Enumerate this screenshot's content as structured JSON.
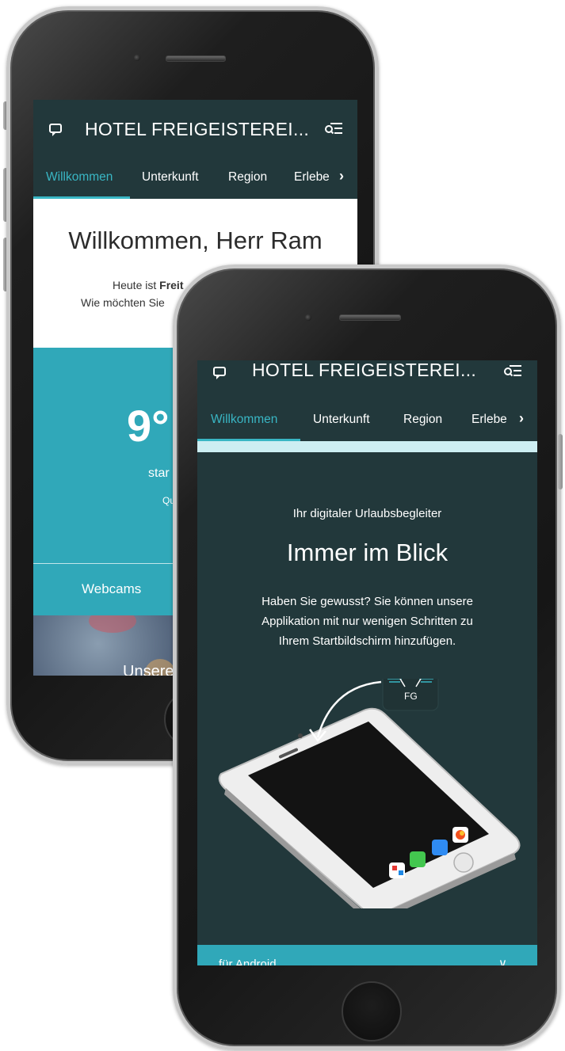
{
  "app": {
    "title": "HOTEL FREIGEISTEREI...",
    "tabs": [
      "Willkommen",
      "Unterkunft",
      "Region",
      "Erlebe"
    ],
    "active_tab": "Willkommen",
    "tab_next_glyph": "›"
  },
  "back_screen": {
    "welcome_title": "Willkommen, Herr Ram",
    "greeting_line1_prefix": "Heute ist ",
    "greeting_line1_bold": "Freit",
    "greeting_line2": "Wie möchten Sie",
    "temperature": "9°",
    "weather_desc": "star",
    "weather_source": "Que",
    "webcams_label": "Webcams",
    "section_title": "Unsere"
  },
  "front_screen": {
    "tagline": "Ihr digitaler Urlaubsbegleiter",
    "heading": "Immer im Blick",
    "info_lines": [
      "Haben Sie gewusst? Sie können unsere",
      "Applikation mit nur wenigen Schritten zu",
      "Ihrem Startbildschirm hinzufügen."
    ],
    "app_icon_label": "FG",
    "android_label": "für Android",
    "android_chevron": "∨"
  },
  "colors": {
    "header_bg": "#22383b",
    "accent": "#39b6c4",
    "weather_bg": "#30a8b9",
    "light_strip": "#cdeef2"
  },
  "icons": [
    "chat-icon",
    "search-menu-icon",
    "chevron-right-icon",
    "chevron-down-icon",
    "fg-app-icon",
    "arrow-curve-icon"
  ]
}
